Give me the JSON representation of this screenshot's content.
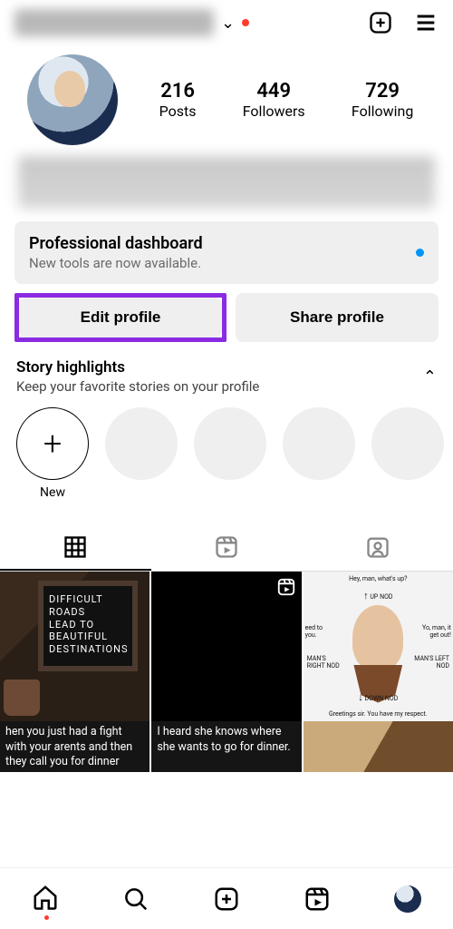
{
  "header": {
    "chevron": "⌄",
    "add_aria": "add-post",
    "menu_aria": "menu"
  },
  "stats": {
    "posts_num": "216",
    "posts_lbl": "Posts",
    "followers_num": "449",
    "followers_lbl": "Followers",
    "following_num": "729",
    "following_lbl": "Following"
  },
  "dashboard": {
    "title": "Professional dashboard",
    "subtitle": "New tools are now available."
  },
  "buttons": {
    "edit": "Edit profile",
    "share": "Share profile"
  },
  "highlights": {
    "title": "Story highlights",
    "subtitle": "Keep your favorite stories on your profile",
    "new_label": "New",
    "chevron": "⌃"
  },
  "grid": {
    "c1_text": "DIFFICULT\nROADS\nLEAD TO\nBEAUTIFUL\nDESTINATIONS",
    "c3_top": "Hey, man, what's up?",
    "c3_upnod": "UP NOD",
    "c3_left1": "eed to you.",
    "c3_right1": "Yo, man, it get out!",
    "c3_leftnod": "MAN'S RIGHT NOD",
    "c3_rightnod": "MAN'S LEFT NOD",
    "c3_down": "DOWN NOD",
    "c3_bottom": "Greetings sir. You have my respect.",
    "c4_text": "hen you just had a fight with your arents and then they call you for dinner",
    "c5_text": "I heard she knows where she wants to go for dinner."
  }
}
